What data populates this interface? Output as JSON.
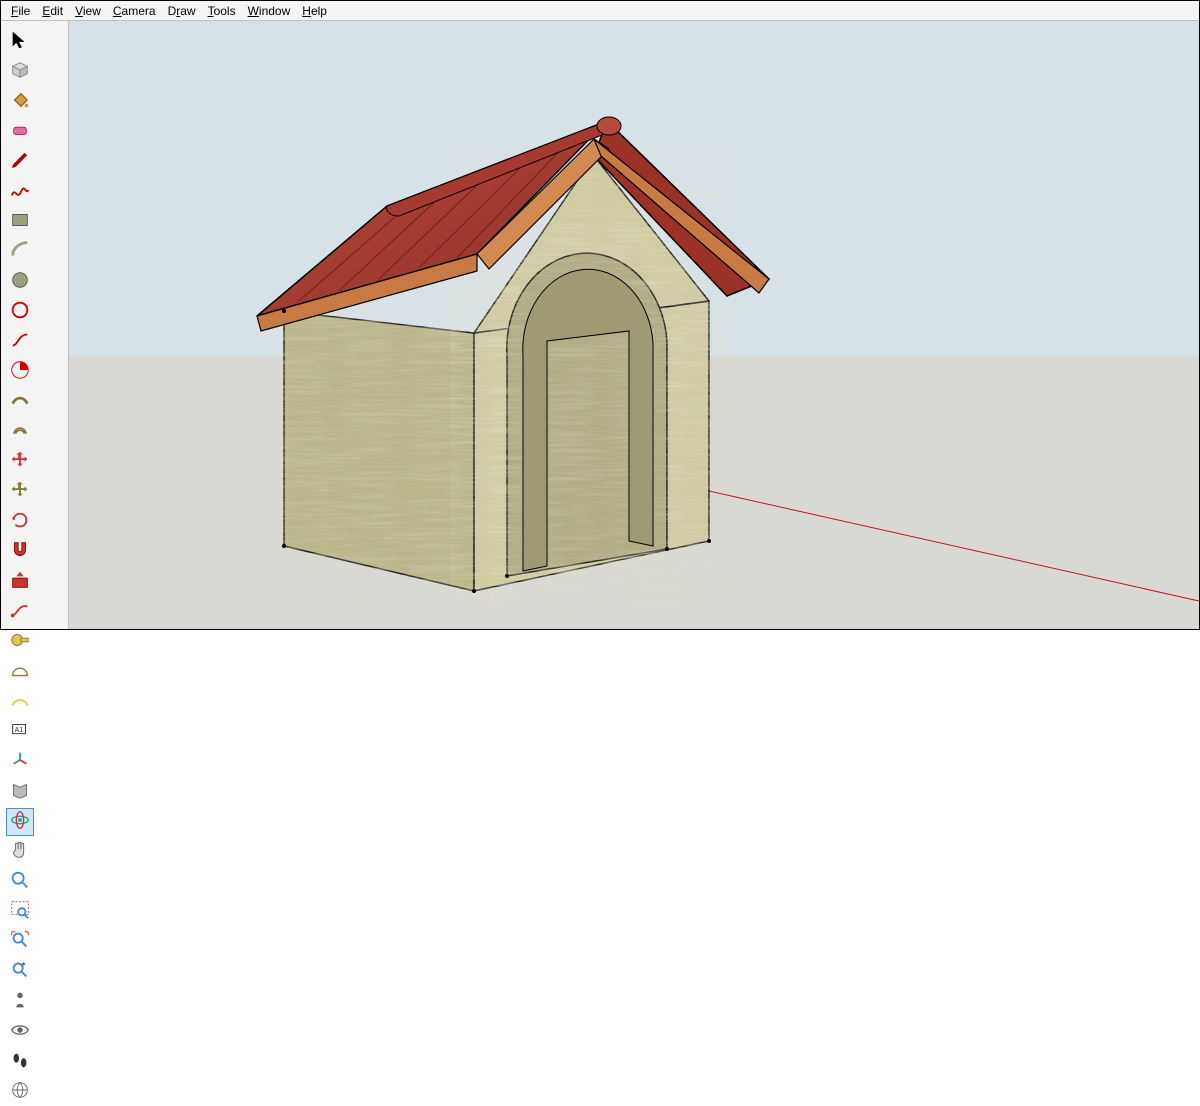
{
  "menu": {
    "file": "File",
    "edit": "Edit",
    "view": "View",
    "camera": "Camera",
    "draw": "Draw",
    "tools": "Tools",
    "window": "Window",
    "help": "Help"
  },
  "active_tool": "orbit",
  "tools": [
    "select",
    "components",
    "paint",
    "eraser",
    "line",
    "freehand",
    "rectangle",
    "arc",
    "circle",
    "polygon",
    "curve",
    "pie",
    "follow-me",
    "offset",
    "move",
    "rotate-copy",
    "rotate",
    "scale",
    "push-pull",
    "follow",
    "tape",
    "protractor",
    "dimension",
    "text",
    "axes",
    "section",
    "orbit",
    "pan",
    "zoom",
    "zoom-window",
    "zoom-extents",
    "previous",
    "position-camera",
    "look-around",
    "walk",
    "shadows"
  ],
  "model": {
    "description": "3D wooden dog-house / small barn with arched doorway and red gabled roof",
    "roof_color": "#a73a2f",
    "trim_color": "#c87a45",
    "wall_color": "#c7c297",
    "ground_color": "#d8d8d4",
    "sky_color": "#d7e2e8",
    "axis_line_color": "#c01818"
  }
}
